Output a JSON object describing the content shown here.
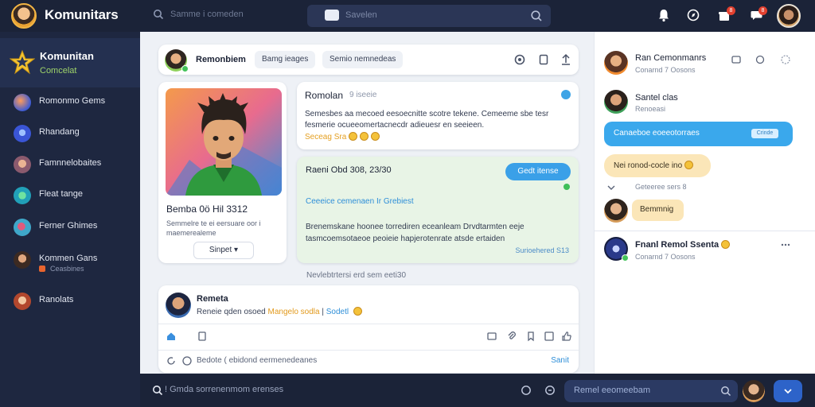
{
  "app": {
    "title": "Komunitars"
  },
  "topbar": {
    "search_hint": "Samme i comeden",
    "search_box_text": "Savelen",
    "notif_badge_1": "8",
    "notif_badge_2": "8"
  },
  "sidebar": {
    "header_title": "Komunitan",
    "header_sub": "Comcelat",
    "items": [
      {
        "label": "Romonmo Gems",
        "sub": ""
      },
      {
        "label": "Rhandang",
        "sub": ""
      },
      {
        "label": "Famnnelobaites",
        "sub": ""
      },
      {
        "label": "Fleat tange",
        "sub": ""
      },
      {
        "label": "Ferner Ghimes",
        "sub": ""
      },
      {
        "label": "Kommen Gans",
        "sub": "Ceasbines"
      },
      {
        "label": "Ranolats",
        "sub": ""
      }
    ]
  },
  "feed": {
    "header": {
      "name": "Remonbiem",
      "chip1": "Bamg ieages",
      "chip2": "Semio nemnedeas"
    },
    "profile_card": {
      "title": "Bemba 0ö Hil 3312",
      "subtitle": "Semmelre te ei eersuare oor i maemerealeme",
      "button": "Sinpet"
    },
    "post1": {
      "title": "Romolan",
      "title_sub": "9 iseeie",
      "body": "Semesbes aa mecoed eesoecnitte scotre tekene. Cemeeme sbe tesr fesmerie ocueeomertacnecdr adieuesr en seeieen.",
      "link": "Seceag Sra"
    },
    "post2": {
      "title": "Raeni Obd 308, 23/30",
      "pill": "Gedt itense",
      "link": "Ceeeice cemenaen Ir Grebiest",
      "body": "Brenemskane hoonee  torrediren eceanleam  Drvdtarmten eeje tasmcoemsotaeoe peoieie hapjerotenrate atsde ertaiden",
      "foot": "Surioehered S13"
    },
    "between_text": "Nevlebtrtersi erd sem eeti30",
    "comment": {
      "name": "Remeta",
      "body_plain": "Reneie qden osoed",
      "body_highlight": "Mangelo sodla",
      "body_link": "Sodetl",
      "input_text": "Bedote ( ebidond eermenedeanes",
      "send": "Sanit"
    }
  },
  "rpanel": {
    "c1_name": "Ran Cemonmanrs",
    "c1_sub": "Conarnd 7 Oosons",
    "c2_name": "Santel clas",
    "c2_sub": "Renoeasi",
    "blue_bubble": "Canaeboe eoeeotorraes",
    "blue_tag": "Crinde",
    "yellow_bubble": "Nei ronod-cocle ino",
    "mini_sub": "Geteeree sers 8",
    "yellow_bubble2": "Bemmnig",
    "c3_name": "Fnanl Remol Ssenta",
    "c3_sub": "Conarnd 7 Oosons"
  },
  "bottombar": {
    "status": "! Gmda sorrenenmom erenses",
    "input_text": "Remel eeomeebam"
  },
  "colors": {
    "accent_blue": "#3aa8ec",
    "online_green": "#43c35a",
    "notif_red": "#e2402f",
    "highlight_yellow": "#fbe6b8"
  }
}
